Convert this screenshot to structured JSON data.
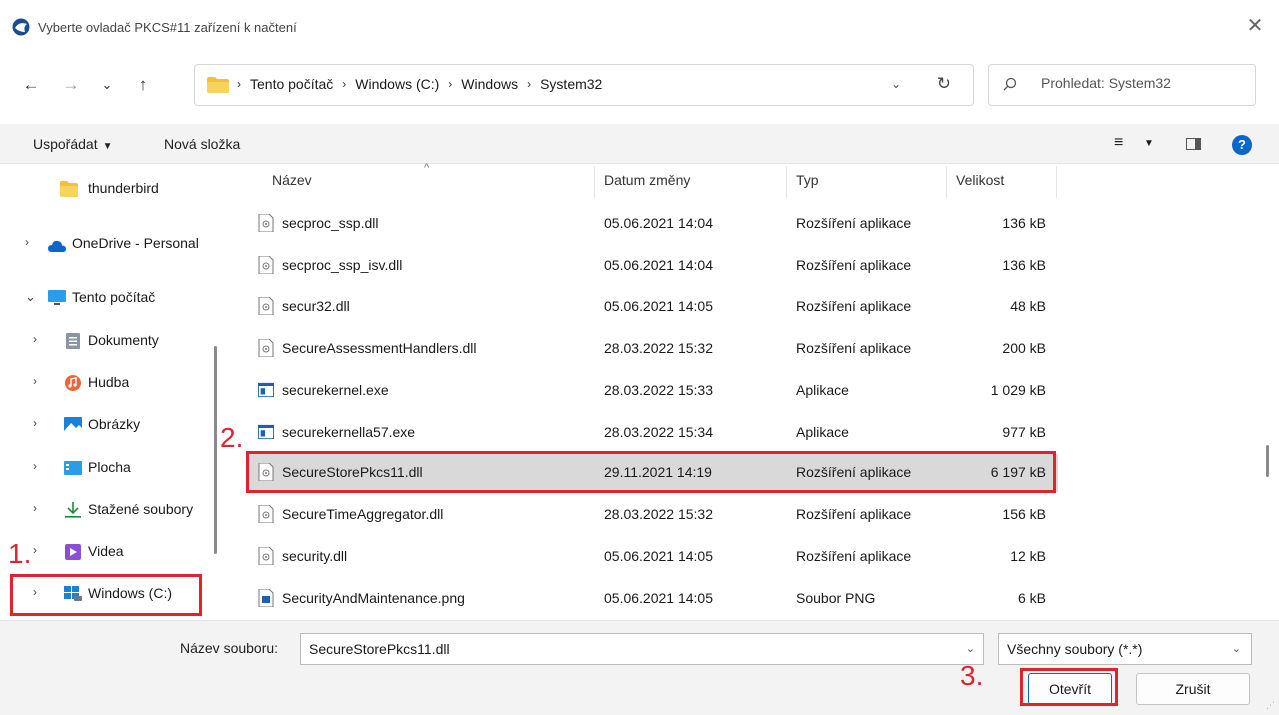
{
  "window": {
    "title": "Vyberte ovladač PKCS#11 zařízení k načtení",
    "close_glyph": "✕"
  },
  "nav": {
    "back_glyph": "←",
    "forward_glyph": "→",
    "recent_glyph": "⌄",
    "up_glyph": "↑",
    "breadcrumb": [
      "Tento počítač",
      "Windows (C:)",
      "Windows",
      "System32"
    ],
    "sep_glyph": "›",
    "dropdown_glyph": "⌄",
    "refresh_glyph": "↻",
    "search_placeholder": "Prohledat: System32"
  },
  "toolbar": {
    "organize_label": "Uspořádat",
    "organize_caret": "▼",
    "new_folder_label": "Nová složka",
    "view_glyph": "≡",
    "view_caret": "▼",
    "help_glyph": "?"
  },
  "sidebar": {
    "items": [
      {
        "label": "thunderbird",
        "chevron": "",
        "icon": "folder-icon"
      },
      {
        "label": "OneDrive - Personal",
        "chevron": "›",
        "icon": "cloud-icon"
      },
      {
        "label": "Tento počítač",
        "chevron": "⌄",
        "icon": "computer-icon"
      },
      {
        "label": "Dokumenty",
        "chevron": "›",
        "icon": "documents-icon"
      },
      {
        "label": "Hudba",
        "chevron": "›",
        "icon": "music-icon"
      },
      {
        "label": "Obrázky",
        "chevron": "›",
        "icon": "pictures-icon"
      },
      {
        "label": "Plocha",
        "chevron": "›",
        "icon": "desktop-icon"
      },
      {
        "label": "Stažené soubory",
        "chevron": "›",
        "icon": "downloads-icon"
      },
      {
        "label": "Videa",
        "chevron": "›",
        "icon": "videos-icon"
      },
      {
        "label": "Windows  (C:)",
        "chevron": "›",
        "icon": "drive-icon"
      }
    ]
  },
  "filelist": {
    "columns": [
      "Název",
      "Datum změny",
      "Typ",
      "Velikost"
    ],
    "sort_glyph": "^",
    "rows": [
      {
        "name": "secproc_ssp.dll",
        "date": "05.06.2021 14:04",
        "type": "Rozšíření aplikace",
        "size": "136 kB",
        "icon": "dll-file-icon"
      },
      {
        "name": "secproc_ssp_isv.dll",
        "date": "05.06.2021 14:04",
        "type": "Rozšíření aplikace",
        "size": "136 kB",
        "icon": "dll-file-icon"
      },
      {
        "name": "secur32.dll",
        "date": "05.06.2021 14:05",
        "type": "Rozšíření aplikace",
        "size": "48 kB",
        "icon": "dll-file-icon"
      },
      {
        "name": "SecureAssessmentHandlers.dll",
        "date": "28.03.2022 15:32",
        "type": "Rozšíření aplikace",
        "size": "200 kB",
        "icon": "dll-file-icon"
      },
      {
        "name": "securekernel.exe",
        "date": "28.03.2022 15:33",
        "type": "Aplikace",
        "size": "1 029 kB",
        "icon": "exe-file-icon"
      },
      {
        "name": "securekernella57.exe",
        "date": "28.03.2022 15:34",
        "type": "Aplikace",
        "size": "977 kB",
        "icon": "exe-file-icon"
      },
      {
        "name": "SecureStorePkcs11.dll",
        "date": "29.11.2021 14:19",
        "type": "Rozšíření aplikace",
        "size": "6 197 kB",
        "icon": "dll-file-icon",
        "selected": true
      },
      {
        "name": "SecureTimeAggregator.dll",
        "date": "28.03.2022 15:32",
        "type": "Rozšíření aplikace",
        "size": "156 kB",
        "icon": "dll-file-icon"
      },
      {
        "name": "security.dll",
        "date": "05.06.2021 14:05",
        "type": "Rozšíření aplikace",
        "size": "12 kB",
        "icon": "dll-file-icon"
      },
      {
        "name": "SecurityAndMaintenance.png",
        "date": "05.06.2021 14:05",
        "type": "Soubor PNG",
        "size": "6 kB",
        "icon": "png-file-icon"
      }
    ]
  },
  "footer": {
    "filename_label": "Název souboru:",
    "filename_value": "SecureStorePkcs11.dll",
    "filename_dd_glyph": "⌄",
    "filetype_value": "Všechny soubory (*.*)",
    "filetype_dd_glyph": "⌄",
    "open_label": "Otevřít",
    "cancel_label": "Zrušit",
    "grip_glyph": "⋰"
  },
  "annotations": {
    "step1": "1.",
    "step2": "2.",
    "step3": "3."
  },
  "colors": {
    "accent": "#0a67c9",
    "annotation": "#e0232f",
    "selected_row": "#d9d9d9",
    "folder": "#f3c03a"
  }
}
